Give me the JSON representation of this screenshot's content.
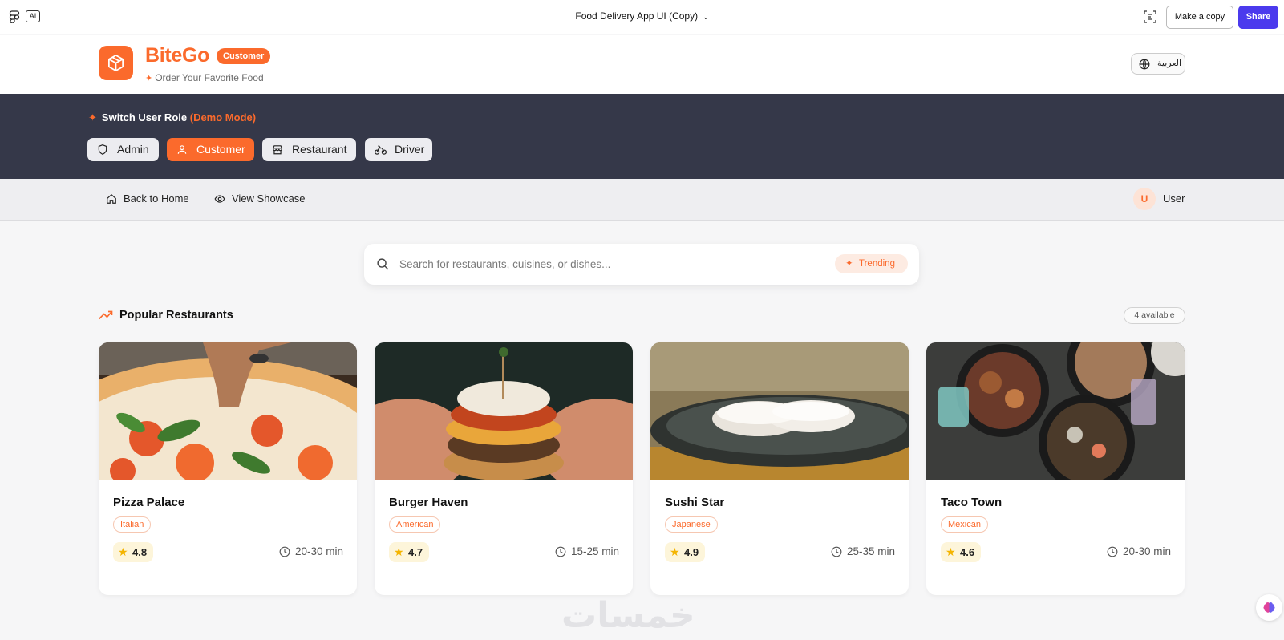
{
  "figma": {
    "ai_label": "AI",
    "file_title": "Food Delivery App UI (Copy)",
    "make_copy": "Make a copy",
    "share": "Share"
  },
  "header": {
    "brand": "BiteGo",
    "role_pill": "Customer",
    "tagline": "Order Your Favorite Food",
    "language_button": "العربية"
  },
  "role_switcher": {
    "title": "Switch User Role",
    "demo": "(Demo Mode)",
    "roles": [
      {
        "label": "Admin",
        "icon": "shield-icon",
        "active": false
      },
      {
        "label": "Customer",
        "icon": "user-icon",
        "active": true
      },
      {
        "label": "Restaurant",
        "icon": "store-icon",
        "active": false
      },
      {
        "label": "Driver",
        "icon": "bike-icon",
        "active": false
      }
    ]
  },
  "nav": {
    "back_home": "Back to Home",
    "view_showcase": "View Showcase",
    "avatar_initial": "U",
    "user_name": "User"
  },
  "search": {
    "placeholder": "Search for restaurants, cuisines, or dishes...",
    "value": "",
    "trending": "Trending"
  },
  "section": {
    "title": "Popular Restaurants",
    "available": "4 available"
  },
  "restaurants": [
    {
      "name": "Pizza Palace",
      "cuisine": "Italian",
      "rating": "4.8",
      "time": "20-30 min"
    },
    {
      "name": "Burger Haven",
      "cuisine": "American",
      "rating": "4.7",
      "time": "15-25 min"
    },
    {
      "name": "Sushi Star",
      "cuisine": "Japanese",
      "rating": "4.9",
      "time": "25-35 min"
    },
    {
      "name": "Taco Town",
      "cuisine": "Mexican",
      "rating": "4.6",
      "time": "20-30 min"
    }
  ],
  "watermark": "خمسات",
  "colors": {
    "brand": "#fb6a2c",
    "role_bar": "#353849",
    "share": "#4b3aed"
  }
}
